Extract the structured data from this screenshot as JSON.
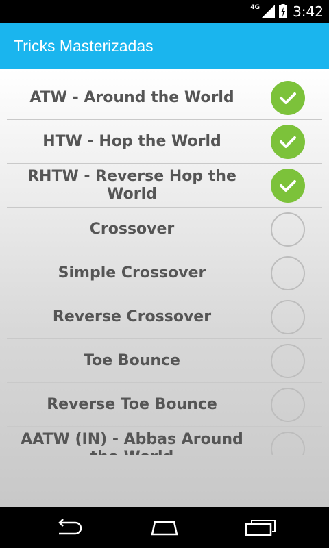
{
  "status_bar": {
    "network_type": "4G",
    "time": "3:42"
  },
  "action_bar": {
    "title": "Tricks Masterizadas"
  },
  "tricks": [
    {
      "label": "ATW - Around the World",
      "mastered": true
    },
    {
      "label": "HTW - Hop the World",
      "mastered": true
    },
    {
      "label": "RHTW - Reverse Hop the World",
      "mastered": true
    },
    {
      "label": "Crossover",
      "mastered": false
    },
    {
      "label": "Simple Crossover",
      "mastered": false
    },
    {
      "label": "Reverse Crossover",
      "mastered": false
    },
    {
      "label": "Toe Bounce",
      "mastered": false
    },
    {
      "label": "Reverse Toe Bounce",
      "mastered": false
    },
    {
      "label": "AATW (IN) - Abbas Around the World",
      "mastered": false
    }
  ],
  "colors": {
    "action_bar": "#1ab5ee",
    "check_on": "#7cc23a",
    "label_text": "#555555"
  },
  "nav_bar": {
    "buttons": [
      "back-icon",
      "home-icon",
      "recent-apps-icon"
    ]
  }
}
